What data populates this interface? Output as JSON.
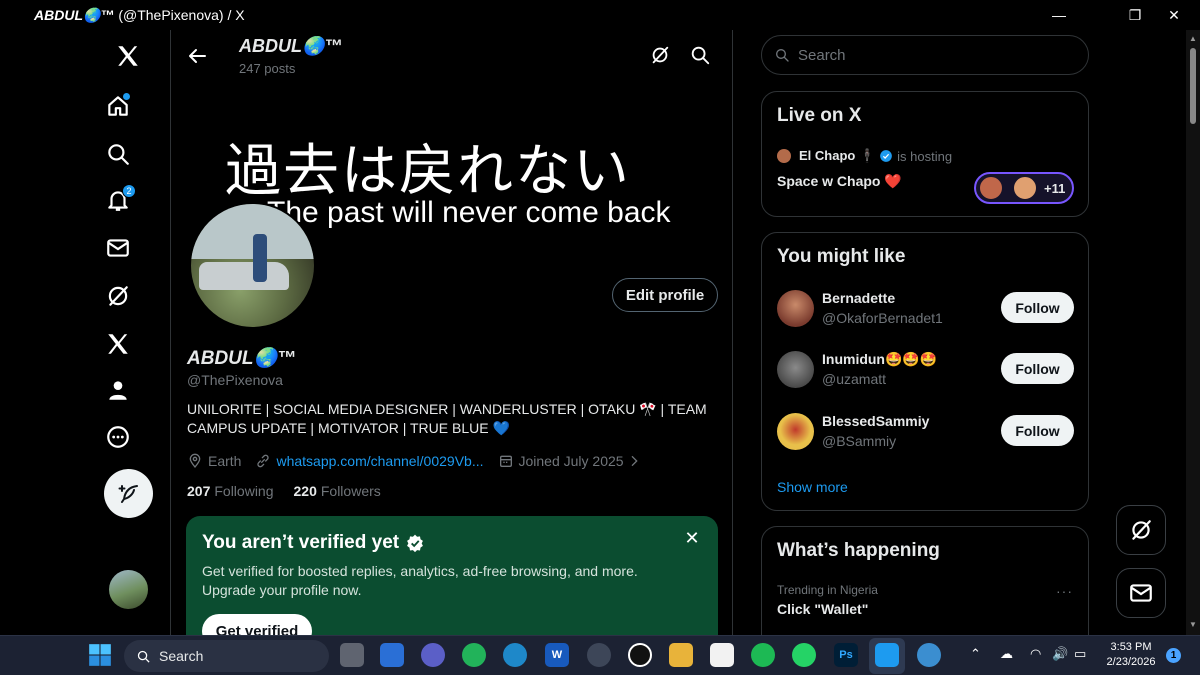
{
  "window": {
    "title_name": "ABDUL🌏™",
    "title_rest": " (@ThePixenova) / X",
    "minimize_label": "—",
    "maximize_label": "❐",
    "close_label": "✕"
  },
  "nav": {
    "notifications_count": "2",
    "icons": [
      "x-logo-icon",
      "home-icon",
      "search-icon",
      "notifications-icon",
      "messages-icon",
      "grok-icon",
      "premium-icon",
      "profile-icon",
      "more-icon"
    ]
  },
  "header": {
    "name": "ABDUL🌏™",
    "posts": "247 posts"
  },
  "banner": {
    "jp_text": "過去は戻れない",
    "en_text": "The past will never come back"
  },
  "profile": {
    "edit_label": "Edit profile",
    "name": "ABDUL🌏™",
    "handle": "@ThePixenova",
    "bio": "UNILORITE | SOCIAL MEDIA DESIGNER | WANDERLUSTER | OTAKU 🎌 | TEAM CAMPUS UPDATE | MOTIVATOR | TRUE BLUE 💙",
    "location": "Earth",
    "link": "whatsapp.com/channel/0029Vb...",
    "joined": "Joined July 2025",
    "following_count": "207",
    "following_label": "Following",
    "followers_count": "220",
    "followers_label": "Followers"
  },
  "verify": {
    "title": "You aren’t verified yet",
    "text": "Get verified for boosted replies, analytics, ad-free browsing, and more. Upgrade your profile now.",
    "button": "Get verified",
    "close": "✕"
  },
  "search": {
    "placeholder": "Search"
  },
  "live": {
    "title": "Live on X",
    "host_name": "El Chapo 🕴🏿",
    "host_status": "is hosting",
    "space": "Space w Chapo",
    "space_heart": "❤️",
    "listeners": "+11"
  },
  "wtf": {
    "title": "You might like",
    "follow_label": "Follow",
    "show_more": "Show more",
    "users": [
      {
        "name": "Bernadette",
        "handle": "@OkaforBernadet1",
        "avatar_color": "#7a3b2e"
      },
      {
        "name": "Inumidun🤩🤩🤩",
        "handle": "@uzamatt",
        "avatar_color": "#5a5a5a"
      },
      {
        "name": "BlessedSammiy",
        "handle": "@BSammiy",
        "avatar_color": "#e8c04a"
      }
    ]
  },
  "trending": {
    "title": "What’s happening",
    "context": "Trending in Nigeria",
    "name": "Click \"Wallet\"",
    "more": "···"
  },
  "taskbar": {
    "search_label": "Search",
    "time": "3:53 PM",
    "date": "2/23/2026",
    "notifications": "1",
    "ps_label": "Ps",
    "word_label": "W"
  },
  "colors": {
    "accent": "#1d9bf0",
    "verify_bg": "#0b4d30",
    "space_border": "#7856ff"
  }
}
